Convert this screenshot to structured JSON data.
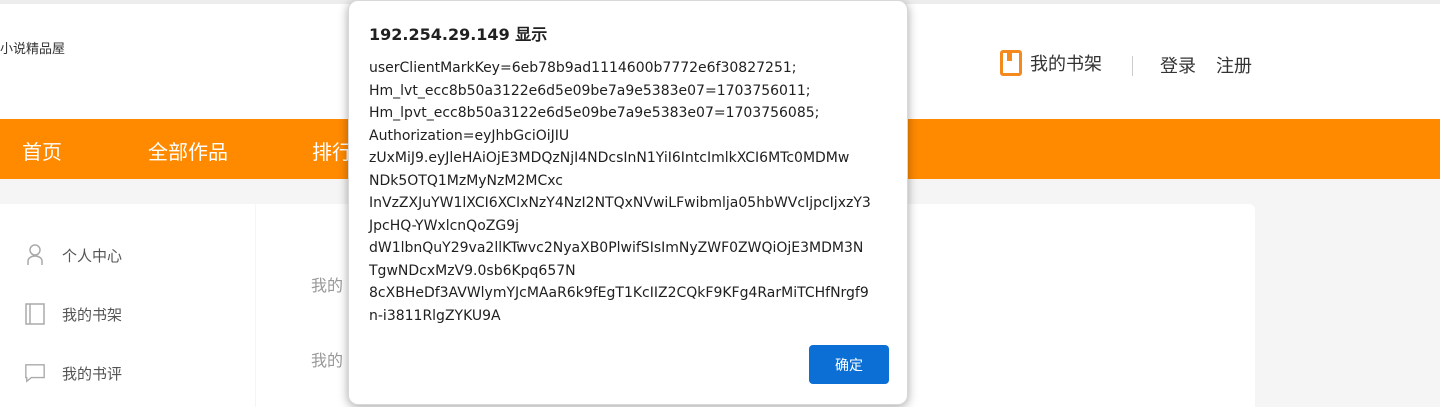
{
  "site": {
    "logo_text": "小说精品屋"
  },
  "header": {
    "shelf_label": "我的书架",
    "login_label": "登录",
    "register_label": "注册"
  },
  "nav": {
    "items": [
      "首页",
      "全部作品",
      "排行"
    ]
  },
  "sidebar": {
    "items": [
      {
        "label": "个人中心",
        "icon": "user-icon"
      },
      {
        "label": "我的书架",
        "icon": "book-icon"
      },
      {
        "label": "我的书评",
        "icon": "comment-icon"
      }
    ]
  },
  "content": {
    "lines": [
      "我的",
      "我的"
    ]
  },
  "dialog": {
    "title": "192.254.29.149 显示",
    "message_lines": [
      "userClientMarkKey=6eb78b9ad1114600b7772e6f30827251;",
      "Hm_lvt_ecc8b50a3122e6d5e09be7a9e5383e07=1703756011;",
      "Hm_lpvt_ecc8b50a3122e6d5e09be7a9e5383e07=1703756085;",
      "Authorization=eyJhbGciOiJIU",
      "zUxMiJ9.eyJleHAiOjE3MDQzNjI4NDcsInN1YiI6IntcImlkXCI6MTc0MDMw",
      "NDk5OTQ1MzMyNzM2MCxc",
      "InVzZXJuYW1lXCI6XCIxNzY4NzI2NTQxNVwiLFwibmlja05hbWVcIjpcIjxzY3",
      "JpcHQ-YWxlcnQoZG9j",
      "dW1lbnQuY29va2llKTwvc2NyaXB0PlwifSIsImNyZWF0ZWQiOjE3MDM3N",
      "TgwNDcxMzV9.0sb6Kpq657N",
      "8cXBHeDf3AVWlymYJcMAaR6k9fEgT1KcIIZ2CQkF9KFg4RarMiTCHfNrgf9",
      "n-i3811RlgZYKU9A"
    ],
    "ok_label": "确定"
  },
  "colors": {
    "nav_bg": "#ff8a00",
    "button_bg": "#0b6fd6",
    "accent": "#f48a1e"
  }
}
